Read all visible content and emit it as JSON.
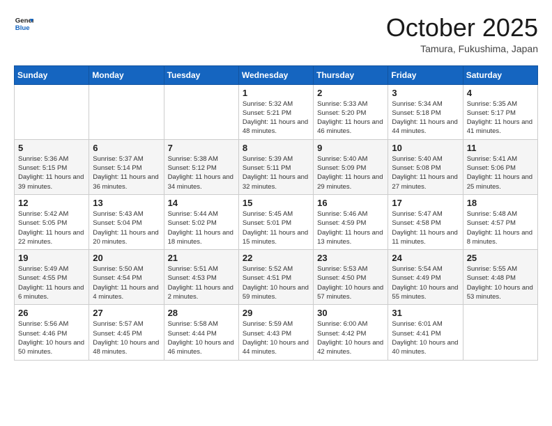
{
  "logo": {
    "general": "General",
    "blue": "Blue"
  },
  "header": {
    "month": "October 2025",
    "location": "Tamura, Fukushima, Japan"
  },
  "weekdays": [
    "Sunday",
    "Monday",
    "Tuesday",
    "Wednesday",
    "Thursday",
    "Friday",
    "Saturday"
  ],
  "weeks": [
    [
      {
        "day": "",
        "info": ""
      },
      {
        "day": "",
        "info": ""
      },
      {
        "day": "",
        "info": ""
      },
      {
        "day": "1",
        "info": "Sunrise: 5:32 AM\nSunset: 5:21 PM\nDaylight: 11 hours\nand 48 minutes."
      },
      {
        "day": "2",
        "info": "Sunrise: 5:33 AM\nSunset: 5:20 PM\nDaylight: 11 hours\nand 46 minutes."
      },
      {
        "day": "3",
        "info": "Sunrise: 5:34 AM\nSunset: 5:18 PM\nDaylight: 11 hours\nand 44 minutes."
      },
      {
        "day": "4",
        "info": "Sunrise: 5:35 AM\nSunset: 5:17 PM\nDaylight: 11 hours\nand 41 minutes."
      }
    ],
    [
      {
        "day": "5",
        "info": "Sunrise: 5:36 AM\nSunset: 5:15 PM\nDaylight: 11 hours\nand 39 minutes."
      },
      {
        "day": "6",
        "info": "Sunrise: 5:37 AM\nSunset: 5:14 PM\nDaylight: 11 hours\nand 36 minutes."
      },
      {
        "day": "7",
        "info": "Sunrise: 5:38 AM\nSunset: 5:12 PM\nDaylight: 11 hours\nand 34 minutes."
      },
      {
        "day": "8",
        "info": "Sunrise: 5:39 AM\nSunset: 5:11 PM\nDaylight: 11 hours\nand 32 minutes."
      },
      {
        "day": "9",
        "info": "Sunrise: 5:40 AM\nSunset: 5:09 PM\nDaylight: 11 hours\nand 29 minutes."
      },
      {
        "day": "10",
        "info": "Sunrise: 5:40 AM\nSunset: 5:08 PM\nDaylight: 11 hours\nand 27 minutes."
      },
      {
        "day": "11",
        "info": "Sunrise: 5:41 AM\nSunset: 5:06 PM\nDaylight: 11 hours\nand 25 minutes."
      }
    ],
    [
      {
        "day": "12",
        "info": "Sunrise: 5:42 AM\nSunset: 5:05 PM\nDaylight: 11 hours\nand 22 minutes."
      },
      {
        "day": "13",
        "info": "Sunrise: 5:43 AM\nSunset: 5:04 PM\nDaylight: 11 hours\nand 20 minutes."
      },
      {
        "day": "14",
        "info": "Sunrise: 5:44 AM\nSunset: 5:02 PM\nDaylight: 11 hours\nand 18 minutes."
      },
      {
        "day": "15",
        "info": "Sunrise: 5:45 AM\nSunset: 5:01 PM\nDaylight: 11 hours\nand 15 minutes."
      },
      {
        "day": "16",
        "info": "Sunrise: 5:46 AM\nSunset: 4:59 PM\nDaylight: 11 hours\nand 13 minutes."
      },
      {
        "day": "17",
        "info": "Sunrise: 5:47 AM\nSunset: 4:58 PM\nDaylight: 11 hours\nand 11 minutes."
      },
      {
        "day": "18",
        "info": "Sunrise: 5:48 AM\nSunset: 4:57 PM\nDaylight: 11 hours\nand 8 minutes."
      }
    ],
    [
      {
        "day": "19",
        "info": "Sunrise: 5:49 AM\nSunset: 4:55 PM\nDaylight: 11 hours\nand 6 minutes."
      },
      {
        "day": "20",
        "info": "Sunrise: 5:50 AM\nSunset: 4:54 PM\nDaylight: 11 hours\nand 4 minutes."
      },
      {
        "day": "21",
        "info": "Sunrise: 5:51 AM\nSunset: 4:53 PM\nDaylight: 11 hours\nand 2 minutes."
      },
      {
        "day": "22",
        "info": "Sunrise: 5:52 AM\nSunset: 4:51 PM\nDaylight: 10 hours\nand 59 minutes."
      },
      {
        "day": "23",
        "info": "Sunrise: 5:53 AM\nSunset: 4:50 PM\nDaylight: 10 hours\nand 57 minutes."
      },
      {
        "day": "24",
        "info": "Sunrise: 5:54 AM\nSunset: 4:49 PM\nDaylight: 10 hours\nand 55 minutes."
      },
      {
        "day": "25",
        "info": "Sunrise: 5:55 AM\nSunset: 4:48 PM\nDaylight: 10 hours\nand 53 minutes."
      }
    ],
    [
      {
        "day": "26",
        "info": "Sunrise: 5:56 AM\nSunset: 4:46 PM\nDaylight: 10 hours\nand 50 minutes."
      },
      {
        "day": "27",
        "info": "Sunrise: 5:57 AM\nSunset: 4:45 PM\nDaylight: 10 hours\nand 48 minutes."
      },
      {
        "day": "28",
        "info": "Sunrise: 5:58 AM\nSunset: 4:44 PM\nDaylight: 10 hours\nand 46 minutes."
      },
      {
        "day": "29",
        "info": "Sunrise: 5:59 AM\nSunset: 4:43 PM\nDaylight: 10 hours\nand 44 minutes."
      },
      {
        "day": "30",
        "info": "Sunrise: 6:00 AM\nSunset: 4:42 PM\nDaylight: 10 hours\nand 42 minutes."
      },
      {
        "day": "31",
        "info": "Sunrise: 6:01 AM\nSunset: 4:41 PM\nDaylight: 10 hours\nand 40 minutes."
      },
      {
        "day": "",
        "info": ""
      }
    ]
  ]
}
